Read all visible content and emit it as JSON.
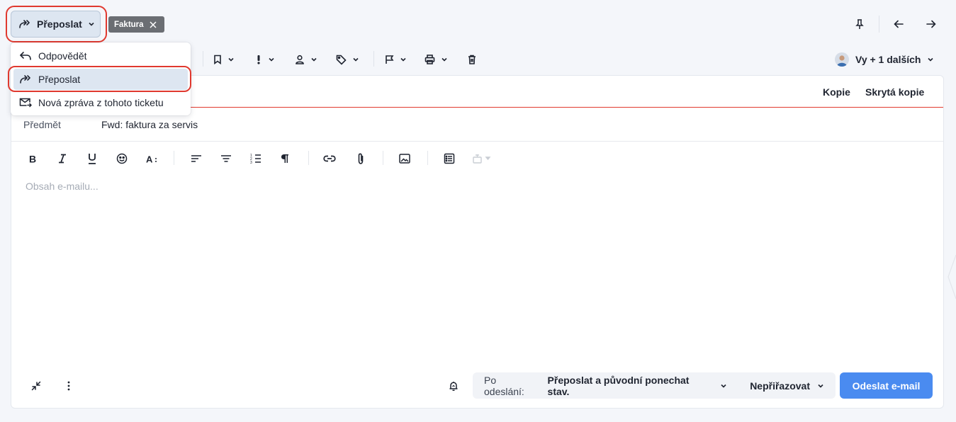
{
  "action_button": {
    "label": "Přeposlat",
    "icon": "forward-icon"
  },
  "tag": {
    "label": "Faktura"
  },
  "top_nav": {
    "pin": "pin-icon",
    "prev": "arrow-left-icon",
    "next": "arrow-right-icon"
  },
  "menu": {
    "items": [
      {
        "label": "Odpovědět",
        "icon": "reply-icon",
        "active": false
      },
      {
        "label": "Přeposlat",
        "icon": "forward-icon",
        "active": true
      },
      {
        "label": "Nová zpráva z tohoto ticketu",
        "icon": "new-mail-icon",
        "active": false
      }
    ]
  },
  "toolbar": {
    "items": [
      "bookmark-icon",
      "priority-icon",
      "assignee-icon",
      "tag-icon",
      "flag-icon",
      "print-icon",
      "trash-icon"
    ],
    "participants": "Vy + 1 dalších"
  },
  "compose": {
    "cc_label": "Kopie",
    "bcc_label": "Skrytá kopie",
    "subject_label": "Předmět",
    "subject_value": "Fwd: faktura za servis",
    "body_placeholder": "Obsah e-mailu...",
    "format_tools": [
      "bold-icon",
      "italic-icon",
      "underline-icon",
      "emoji-icon",
      "font-size-icon",
      "align-left-icon",
      "align-center-icon",
      "ordered-list-icon",
      "paragraph-icon",
      "link-icon",
      "attachment-icon",
      "image-icon",
      "template-icon",
      "signature-icon"
    ]
  },
  "footer": {
    "after_send_label": "Po odeslání:",
    "after_send_value": "Přeposlat a původní ponechat stav.",
    "assign_value": "Nepřiřazovat",
    "send_label": "Odeslat e-mail"
  },
  "colors": {
    "accent": "#4a8bf0",
    "highlight_ring": "#e0392f",
    "tag_bg": "#6b6e73",
    "active_bg": "#dde6f1"
  }
}
